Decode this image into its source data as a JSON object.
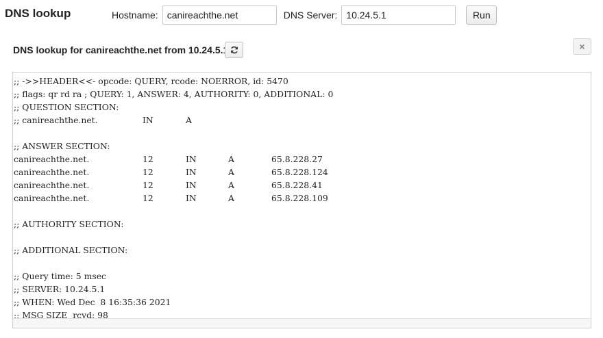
{
  "app": {
    "title": "DNS lookup"
  },
  "toolbar": {
    "hostname_label": "Hostname:",
    "hostname_value": "canireachthe.net",
    "dns_label": "DNS Server:",
    "dns_value": "10.24.5.1",
    "run_label": "Run"
  },
  "result": {
    "title": "DNS lookup for canireachthe.net from 10.24.5.1",
    "refresh_icon": "refresh-icon",
    "close_label": "×",
    "lines": [
      ";; ->>HEADER<<- opcode: QUERY, rcode: NOERROR, id: 5470",
      ";; flags: qr rd ra ; QUERY: 1, ANSWER: 4, AUTHORITY: 0, ADDITIONAL: 0",
      ";; QUESTION SECTION:",
      ";; canireachthe.net.\tIN\tA",
      "",
      ";; ANSWER SECTION:",
      "canireachthe.net.\t12\tIN\tA\t65.8.228.27",
      "canireachthe.net.\t12\tIN\tA\t65.8.228.124",
      "canireachthe.net.\t12\tIN\tA\t65.8.228.41",
      "canireachthe.net.\t12\tIN\tA\t65.8.228.109",
      "",
      ";; AUTHORITY SECTION:",
      "",
      ";; ADDITIONAL SECTION:",
      "",
      ";; Query time: 5 msec",
      ";; SERVER: 10.24.5.1",
      ";; WHEN: Wed Dec  8 16:35:36 2021",
      ";; MSG SIZE  rcvd: 98"
    ]
  }
}
